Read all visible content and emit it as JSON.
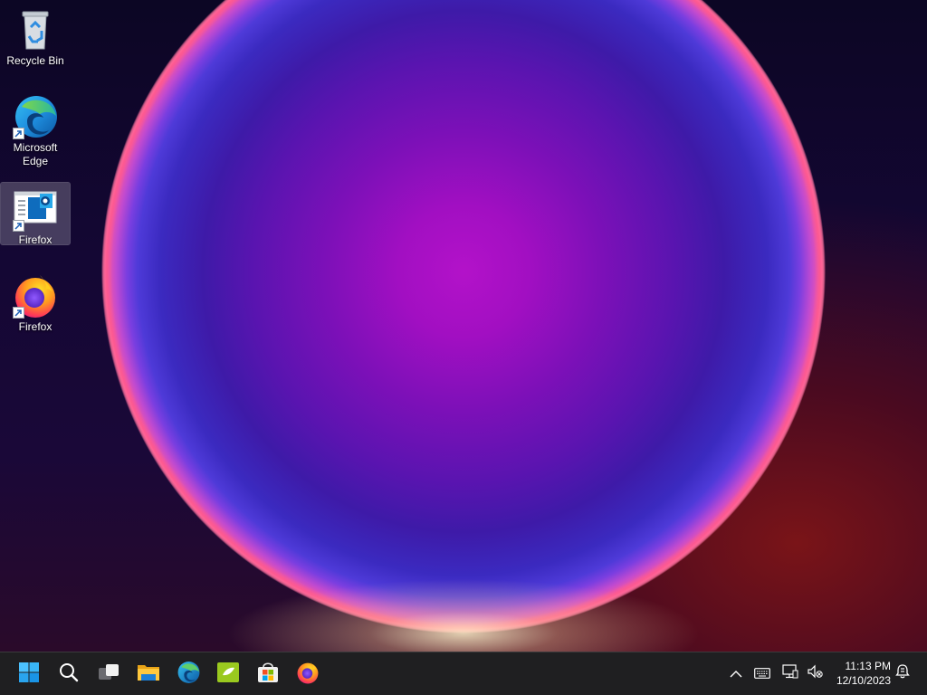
{
  "desktop": {
    "icons": [
      {
        "label": "Recycle Bin",
        "icon": "recycle-bin-icon",
        "shortcut": false,
        "selected": false
      },
      {
        "label": "Microsoft Edge",
        "label_lines": [
          "Microsoft",
          "Edge"
        ],
        "icon": "edge-icon",
        "shortcut": true,
        "selected": false
      },
      {
        "label": "Firefox",
        "icon": "outlook-installer-icon",
        "shortcut": true,
        "selected": true
      },
      {
        "label": "Firefox",
        "icon": "firefox-icon",
        "shortcut": true,
        "selected": false
      }
    ]
  },
  "taskbar": {
    "pinned": [
      {
        "name": "start-button",
        "icon": "windows-start-icon"
      },
      {
        "name": "search-button",
        "icon": "search-icon"
      },
      {
        "name": "task-view-button",
        "icon": "task-view-icon"
      },
      {
        "name": "file-explorer-button",
        "icon": "folder-icon"
      },
      {
        "name": "edge-taskbar-button",
        "icon": "edge-icon"
      },
      {
        "name": "app-taskbar-button",
        "icon": "green-app-icon"
      },
      {
        "name": "store-taskbar-button",
        "icon": "microsoft-store-icon"
      },
      {
        "name": "firefox-taskbar-button",
        "icon": "firefox-icon"
      }
    ],
    "tray": {
      "icons": [
        "chevron-up-icon",
        "keyboard-icon",
        "network-icon",
        "volume-muted-icon"
      ],
      "time": "11:13 PM",
      "date": "12/10/2023",
      "notification_icon": "notification-icon"
    }
  },
  "colors": {
    "taskbar_bg": "#1f1f21",
    "accent": "#0078d4"
  }
}
